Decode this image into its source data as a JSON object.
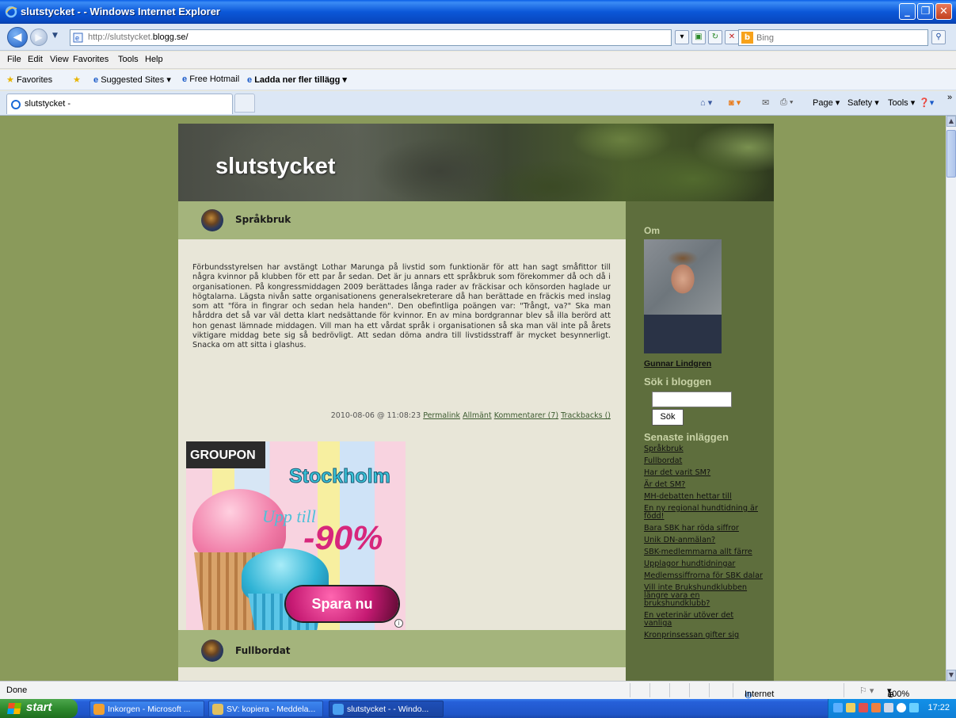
{
  "window": {
    "title": "slutstycket - - Windows Internet Explorer",
    "minimize": "_",
    "restore": "❐",
    "close": "✕"
  },
  "address": {
    "url_prefix": "http://slutstycket.",
    "url_domain": "blogg.se/",
    "search_placeholder": "Bing"
  },
  "menu": [
    "File",
    "Edit",
    "View",
    "Favorites",
    "Tools",
    "Help"
  ],
  "favorites": {
    "label": "Favorites",
    "suggested": "Suggested Sites ▾",
    "hotmail": "Free Hotmail",
    "addons": "Ladda ner fler tillägg ▾"
  },
  "tab": {
    "label": "slutstycket -"
  },
  "commands": {
    "page": "Page ▾",
    "safety": "Safety ▾",
    "tools": "Tools ▾"
  },
  "blog": {
    "title": "slutstycket",
    "posts": [
      {
        "title": "Språkbruk",
        "body": "Förbundsstyrelsen har avstängt Lothar Marunga på livstid som funktionär för att han sagt småfittor till några kvinnor på klubben för ett par år sedan. Det är ju annars ett språkbruk som förekommer då och då i organisationen. På kongressmiddagen 2009 berättades långa rader av fräckisar och könsorden haglade ur högtalarna. Lägsta nivån satte organisationens generalsekreterare då han berättade en fräckis med inslag som att \"föra in fingrar och sedan hela handen\". Den obefintliga poängen var: \"Trångt, va?\" Ska man hårddra det så var väl detta klart nedsättande för kvinnor. En av mina bordgrannar blev så illa berörd att hon genast lämnade middagen. Vill man ha ett vårdat språk i organisationen så ska man väl inte på årets viktigare middag bete sig så bedrövligt. Att sedan döma andra till livstidsstraff är mycket besynnerligt. Snacka om att sitta i glashus.",
        "timestamp": "2010-08-06 @ 11:08:23",
        "permalink": "Permalink",
        "category": "Allmänt",
        "comments": "Kommentarer (7)",
        "trackbacks": "Trackbacks ()"
      },
      {
        "title": "Fullbordat"
      }
    ],
    "ad": {
      "brand": "GROUPON",
      "city": "Stockholm",
      "upto": "Upp till",
      "discount": "-90%",
      "cta": "Spara nu",
      "info": "i"
    },
    "sidebar": {
      "about_heading": "Om",
      "author": "Gunnar Lindgren",
      "search_heading": "Sök i bloggen",
      "search_button": "Sök",
      "recent_heading": "Senaste inläggen",
      "recent": [
        "Språkbruk",
        "Fullbordat",
        "Har det varit SM?",
        "Är det SM?",
        "MH-debatten hettar till",
        "En ny regional hundtidning är född!",
        "Bara SBK har röda siffror",
        "Unik DN-anmälan?",
        "SBK-medlemmarna allt färre",
        "Upplagor hundtidningar",
        "Medlemssiffrorna för SBK dalar",
        "Vill inte Brukshundklubben längre vara en brukshundklubb?",
        "En veterinär utöver det vanliga",
        "Kronprinsessan gifter sig"
      ]
    }
  },
  "status": {
    "done": "Done",
    "zone": "Internet",
    "zoom": "100%"
  },
  "taskbar": {
    "start": "start",
    "buttons": [
      "Inkorgen - Microsoft ...",
      "SV: kopiera - Meddela...",
      "slutstycket - - Windo..."
    ],
    "clock": "17:22"
  },
  "colors": {
    "page_bg": "#8a9a5b",
    "post_header": "#a4b47c",
    "post_body": "#e8e6d8",
    "sidebar": "#5e6e3d",
    "sidebar_heading": "#c8d2a6"
  }
}
